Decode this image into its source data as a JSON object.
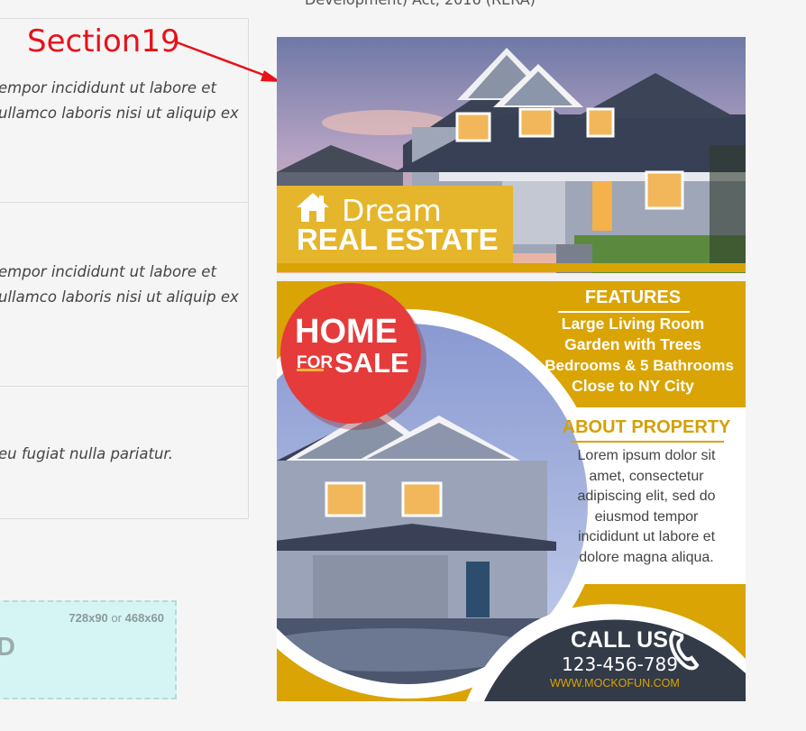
{
  "page": {
    "top_cut_text": "Development) Act, 2016 (RERA)"
  },
  "faq": [
    {
      "lines": [
        "empor incididunt ut labore et",
        "ullamco laboris nisi ut aliquip ex"
      ]
    },
    {
      "lines": [
        "empor incididunt ut labore et",
        "ullamco laboris nisi ut aliquip ex"
      ]
    },
    {
      "lines": [
        "eu fugiat nulla pariatur."
      ]
    }
  ],
  "ad": {
    "size_primary": "728x90",
    "size_or": "or",
    "size_secondary": "468x60",
    "letter": "D"
  },
  "annotation": {
    "label": "Section19",
    "color": "#e8111a"
  },
  "flyer": {
    "brand_small": "Dream",
    "brand_big": "REAL ESTATE",
    "badge_top": "HOME",
    "badge_for": "FOR",
    "badge_sale": "SALE",
    "features_title": "FEATURES",
    "features": [
      "Large Living Room",
      "Garden with Trees",
      "4 Bedrooms & 5 Bathrooms",
      "Close to NY City"
    ],
    "about_title": "ABOUT PROPERTY",
    "about_lines": [
      "Lorem ipsum dolor sit",
      "amet, consectetur",
      "adipiscing elit, sed do",
      "eiusmod tempor",
      "incididunt ut labore et",
      "dolore magna aliqua."
    ],
    "call_title": "CALL US",
    "phone": "123-456-789",
    "website": "WWW.MOCKOFUN.COM",
    "colors": {
      "gold": "#d9a404",
      "red": "#e53b3b",
      "navy": "#333a48"
    }
  },
  "icons": {
    "home": "home-icon",
    "phone": "phone-icon"
  }
}
